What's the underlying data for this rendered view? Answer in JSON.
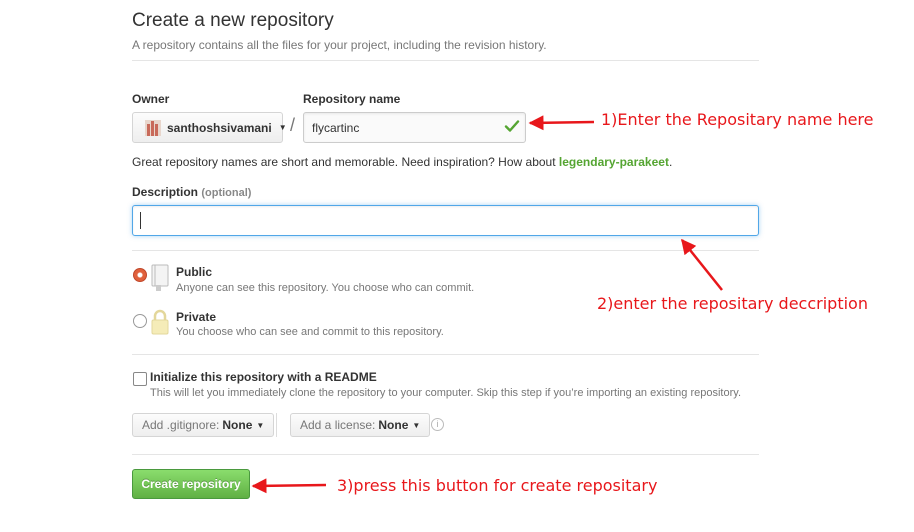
{
  "header": {
    "title": "Create a new repository",
    "subtitle": "A repository contains all the files for your project, including the revision history."
  },
  "owner": {
    "label": "Owner",
    "value": "santhoshsivamani"
  },
  "repository_name": {
    "label": "Repository name",
    "value": "flycartinc",
    "valid": true
  },
  "separator": "/",
  "hint": {
    "text": "Great repository names are short and memorable. Need inspiration? How about ",
    "suggestion": "legendary-parakeet",
    "suffix": "."
  },
  "description": {
    "label": "Description",
    "optional": "(optional)",
    "value": ""
  },
  "visibility": {
    "selected": "public",
    "options": [
      {
        "id": "public",
        "title": "Public",
        "desc": "Anyone can see this repository. You choose who can commit."
      },
      {
        "id": "private",
        "title": "Private",
        "desc": "You choose who can see and commit to this repository."
      }
    ]
  },
  "readme": {
    "label": "Initialize this repository with a README",
    "desc": "This will let you immediately clone the repository to your computer. Skip this step if you’re importing an existing repository.",
    "checked": false
  },
  "gitignore": {
    "label": "Add .gitignore:",
    "value": "None"
  },
  "license": {
    "label": "Add a license:",
    "value": "None"
  },
  "info_glyph": "i",
  "create_button": {
    "label": "Create repository"
  },
  "annotations": {
    "one": "1)Enter the Repositary name here",
    "two": "2)enter the repositary deccription",
    "three": "3)press this button for create repositary"
  },
  "colors": {
    "accent_green": "#60b044",
    "suggestion_green": "#55a532",
    "focus_blue": "#51a7e8",
    "annotation_red": "#e8171b",
    "radio_orange": "#e0603c"
  },
  "icons": [
    "avatar-icon",
    "check-icon",
    "book-repo-icon",
    "lock-icon",
    "info-icon",
    "caret-down-icon"
  ]
}
